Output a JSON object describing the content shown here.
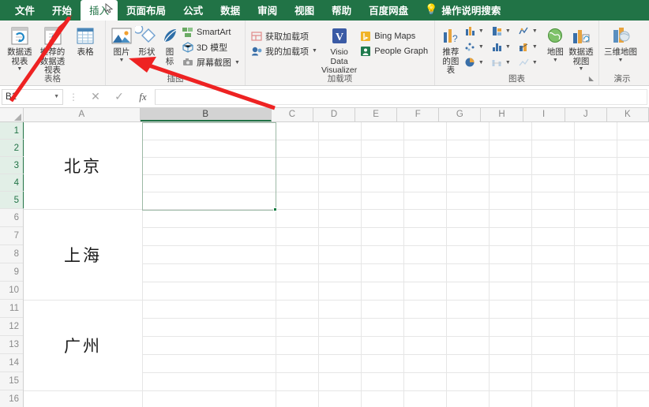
{
  "app": {
    "tabs": [
      {
        "label": "文件",
        "active": false
      },
      {
        "label": "开始",
        "active": false
      },
      {
        "label": "插入",
        "active": true
      },
      {
        "label": "页面布局",
        "active": false
      },
      {
        "label": "公式",
        "active": false
      },
      {
        "label": "数据",
        "active": false
      },
      {
        "label": "审阅",
        "active": false
      },
      {
        "label": "视图",
        "active": false
      },
      {
        "label": "帮助",
        "active": false
      },
      {
        "label": "百度网盘",
        "active": false
      }
    ],
    "tell_me": "操作说明搜索",
    "lamp_icon": "lightbulb-icon",
    "cursor_icon": "mouse-pointer-icon"
  },
  "ribbon": {
    "groups": [
      {
        "name": "tables",
        "label": "表格",
        "buttons": [
          {
            "label": "数据透视表",
            "icon": "pivot-table-icon",
            "caret": true
          },
          {
            "label": "推荐的数据透视表",
            "icon": "recommended-pivot-table-icon",
            "caret": false
          },
          {
            "label": "表格",
            "icon": "table-icon",
            "caret": false
          }
        ]
      },
      {
        "name": "illustrations",
        "label": "插图",
        "buttons": [
          {
            "label": "图片",
            "icon": "picture-icon",
            "caret": true
          },
          {
            "label": "形状",
            "icon": "shapes-icon",
            "caret": true
          },
          {
            "label": "图标",
            "icon": "icons-icon",
            "caret": false
          }
        ],
        "small_buttons": [
          {
            "label": "SmartArt",
            "icon": "smartart-icon",
            "caret": false
          },
          {
            "label": "3D 模型",
            "icon": "3d-model-icon",
            "caret": false
          },
          {
            "label": "屏幕截图",
            "icon": "screenshot-icon",
            "caret": true
          }
        ]
      },
      {
        "name": "addins",
        "label": "加载项",
        "small_buttons": [
          {
            "label": "获取加载项",
            "icon": "get-addins-icon",
            "caret": false
          },
          {
            "label": "我的加载项",
            "icon": "my-addins-icon",
            "caret": true
          }
        ],
        "buttons": [
          {
            "label": "Visio Data Visualizer",
            "icon": "visio-data-visualizer-icon",
            "caret": false
          }
        ],
        "small_buttons2": [
          {
            "label": "Bing Maps",
            "icon": "bing-maps-icon",
            "caret": false
          },
          {
            "label": "People Graph",
            "icon": "people-graph-icon",
            "caret": false
          }
        ]
      },
      {
        "name": "charts",
        "label": "图表",
        "dialog_launcher": "chart-dialog-launcher",
        "buttons": [
          {
            "label": "推荐的图表",
            "icon": "recommended-charts-icon",
            "caret": false
          },
          {
            "label": "地图",
            "icon": "map-chart-icon",
            "caret": true
          },
          {
            "label": "数据透视图",
            "icon": "pivot-chart-icon",
            "caret": true
          }
        ],
        "chart_types": [
          {
            "icon": "column-chart-icon"
          },
          {
            "icon": "waterfall-chart-icon"
          },
          {
            "icon": "line-chart-icon"
          },
          {
            "icon": "scatter-chart-icon"
          },
          {
            "icon": "hierarchy-chart-icon"
          },
          {
            "icon": "combo-chart-icon"
          },
          {
            "icon": "pie-chart-icon"
          },
          {
            "icon": "statistic-chart-icon"
          },
          {
            "icon": "sparkline-chart-icon"
          }
        ]
      },
      {
        "name": "tours",
        "label": "演示",
        "buttons": [
          {
            "label": "三维地图",
            "icon": "3d-map-icon",
            "caret": true
          }
        ]
      }
    ]
  },
  "formula_bar": {
    "name_box_value": "B1",
    "cancel_icon": "close-icon",
    "confirm_icon": "check-icon",
    "function_icon": "fx-icon",
    "formula_value": ""
  },
  "grid": {
    "columns": [
      "A",
      "B",
      "C",
      "D",
      "E",
      "F",
      "G",
      "H",
      "I",
      "J",
      "K"
    ],
    "selected_column": "B",
    "rows": [
      "1",
      "2",
      "3",
      "4",
      "5",
      "6",
      "7",
      "8",
      "9",
      "10",
      "11",
      "12",
      "13",
      "14",
      "15",
      "16"
    ],
    "selected_rows": [
      "1",
      "2",
      "3",
      "4",
      "5"
    ],
    "merged_cells": [
      {
        "ref": "A1:A5",
        "value": "北京"
      },
      {
        "ref": "A6:A10",
        "value": "上海"
      },
      {
        "ref": "A11:A15",
        "value": "广州"
      }
    ],
    "active_selection": "B1:B5"
  },
  "annotations": {
    "arrow_color": "#ee2222",
    "arrows": [
      {
        "name": "arrow-to-insert-tab",
        "from": "name-box",
        "to": "插入"
      },
      {
        "name": "arrow-to-picture-button",
        "from": "column-b-header",
        "to": "图片"
      }
    ]
  }
}
